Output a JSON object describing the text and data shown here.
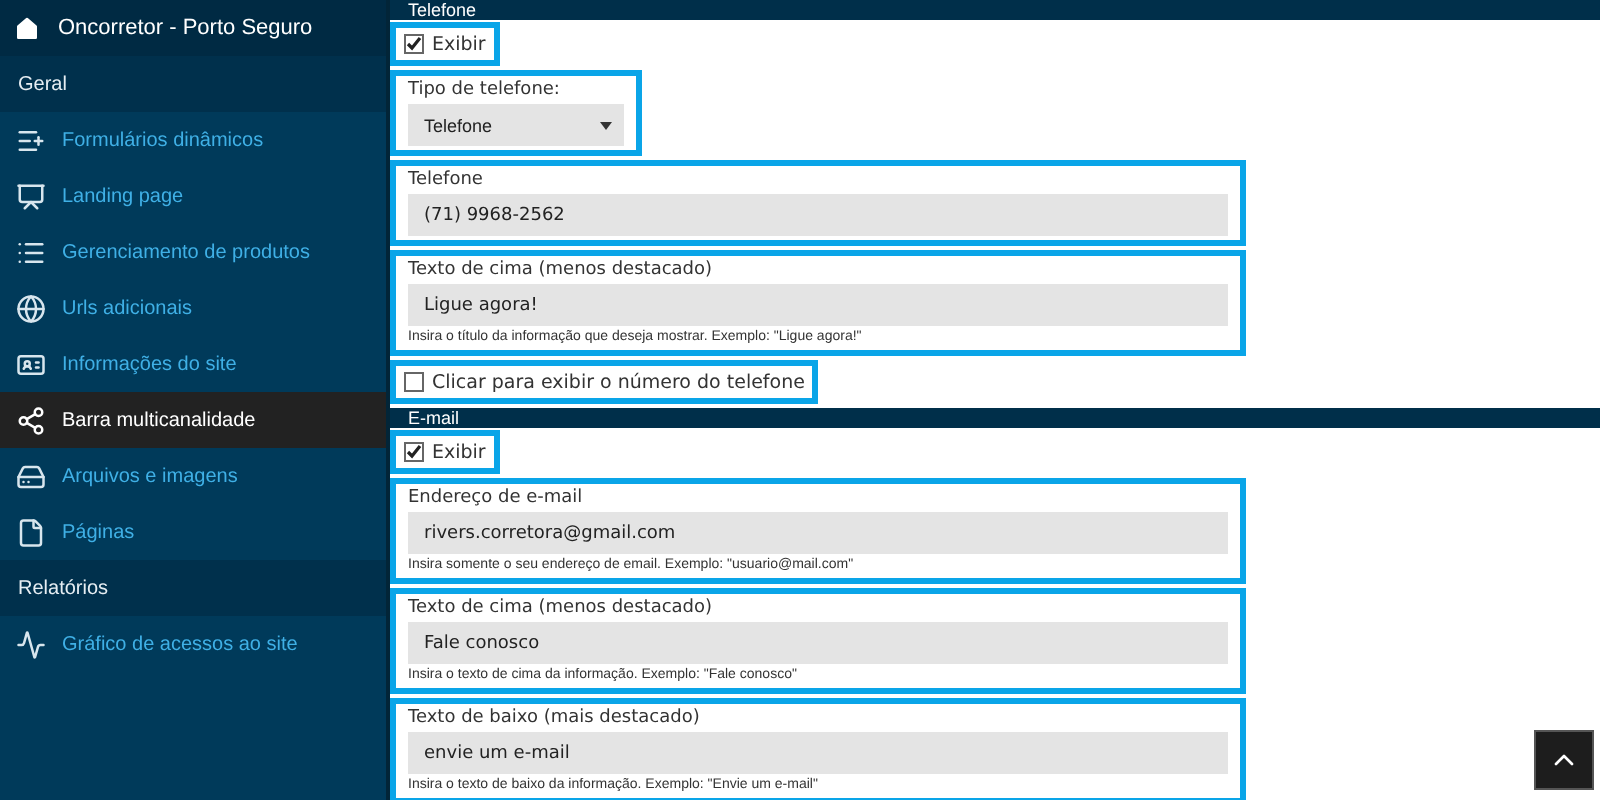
{
  "sidebar": {
    "title": "Oncorretor - Porto Seguro",
    "groups": [
      {
        "heading": "Geral",
        "items": [
          {
            "label": "Formulários dinâmicos",
            "selected": false
          },
          {
            "label": "Landing page",
            "selected": false
          },
          {
            "label": "Gerenciamento de produtos",
            "selected": false
          },
          {
            "label": "Urls adicionais",
            "selected": false
          },
          {
            "label": "Informações do site",
            "selected": false
          },
          {
            "label": "Barra multicanalidade",
            "selected": true
          },
          {
            "label": "Arquivos e imagens",
            "selected": false
          },
          {
            "label": "Páginas",
            "selected": false
          }
        ]
      },
      {
        "heading": "Relatórios",
        "items": [
          {
            "label": "Gráfico de acessos ao site",
            "selected": false
          }
        ]
      }
    ]
  },
  "sections": [
    {
      "title": "Telefone",
      "fields": [
        {
          "kind": "checkbox",
          "label": "Exibir",
          "checked": true
        },
        {
          "kind": "select",
          "label": "Tipo de telefone:",
          "value": "Telefone"
        },
        {
          "kind": "text",
          "label": "Telefone",
          "value": "(71) 9968-2562"
        },
        {
          "kind": "text",
          "label": "Texto de cima (menos destacado)",
          "value": "Ligue agora!",
          "hint": "Insira o título da informação que deseja mostrar. Exemplo: \"Ligue agora!\""
        },
        {
          "kind": "checkbox",
          "label": "Clicar para exibir o número do telefone",
          "checked": false
        }
      ]
    },
    {
      "title": "E-mail",
      "fields": [
        {
          "kind": "checkbox",
          "label": "Exibir",
          "checked": true
        },
        {
          "kind": "text",
          "label": "Endereço de e-mail",
          "value": "rivers.corretora@gmail.com",
          "hint": "Insira somente o seu endereço de email. Exemplo: \"usuario@mail.com\""
        },
        {
          "kind": "text",
          "label": "Texto de cima (menos destacado)",
          "value": "Fale conosco",
          "hint": "Insira o texto de cima da informação. Exemplo: \"Fale conosco\""
        },
        {
          "kind": "text",
          "label": "Texto de baixo (mais destacado)",
          "value": "envie um e-mail",
          "hint": "Insira o texto de baixo da informação. Exemplo: \"Envie um e-mail\""
        }
      ]
    }
  ]
}
